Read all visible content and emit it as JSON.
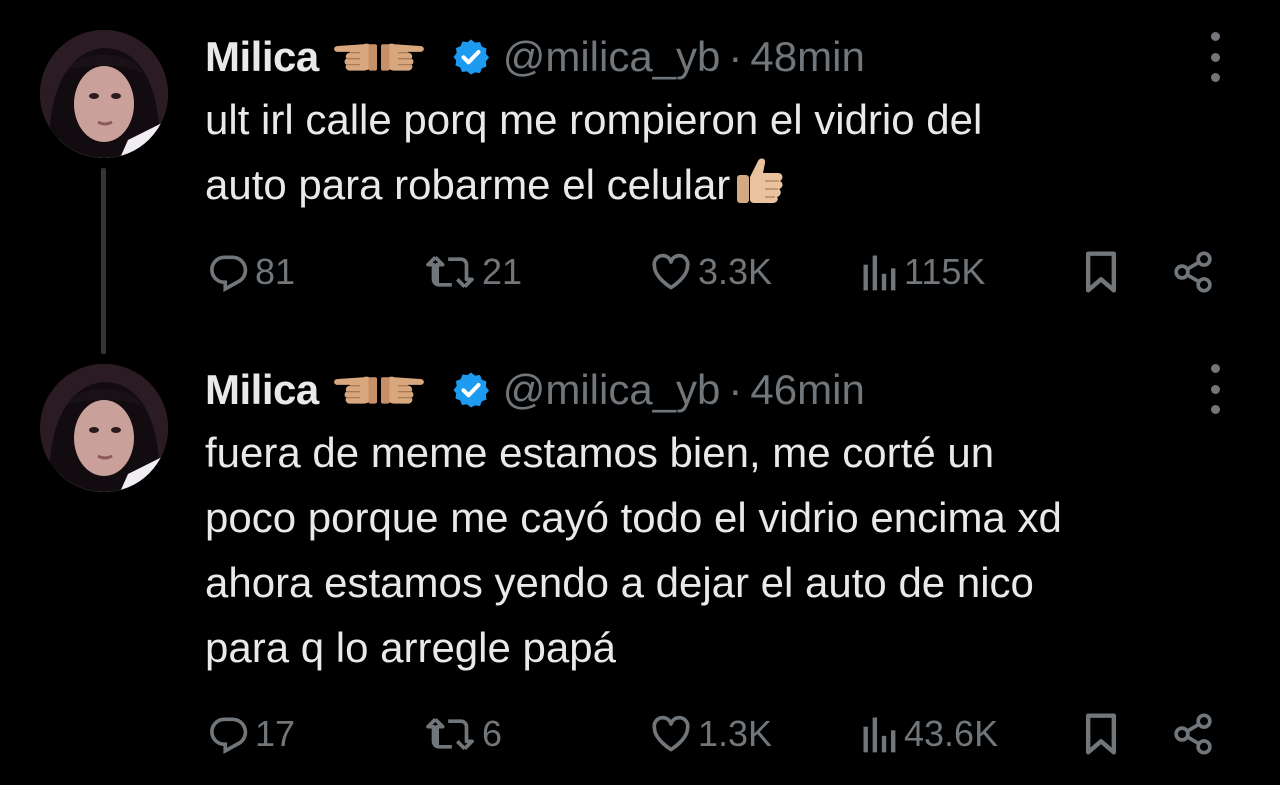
{
  "tweets": [
    {
      "name": "Milica",
      "handle": "@milica_yb",
      "separator": "·",
      "time": "48min",
      "text_lines": [
        "ult irl calle porq me rompieron el vidrio del",
        "auto para robarme el celular"
      ],
      "emoji_end": "thumbs-up",
      "stats": {
        "replies": "81",
        "retweets": "21",
        "likes": "3.3K",
        "views": "115K"
      }
    },
    {
      "name": "Milica",
      "handle": "@milica_yb",
      "separator": "·",
      "time": "46min",
      "text_lines": [
        "fuera de meme estamos bien, me corté un",
        "poco porque me cayó todo el vidrio encima xd",
        "ahora estamos yendo a dejar el auto de nico",
        "para q lo arregle papá"
      ],
      "stats": {
        "replies": "17",
        "retweets": "6",
        "likes": "1.3K",
        "views": "43.6K"
      }
    }
  ],
  "icons": {
    "verified": "verified-badge-icon",
    "reply": "reply-icon",
    "retweet": "retweet-icon",
    "like": "heart-icon",
    "views": "views-icon",
    "bookmark": "bookmark-icon",
    "share": "share-icon",
    "more": "more-icon",
    "name_emoji": "pointing-hands-icon"
  },
  "colors": {
    "background": "#000000",
    "text": "#e7e9ea",
    "secondary": "#71767b",
    "verified": "#1d9bf0",
    "thread_line": "#333639",
    "emoji_skin": "#d9a77d"
  }
}
